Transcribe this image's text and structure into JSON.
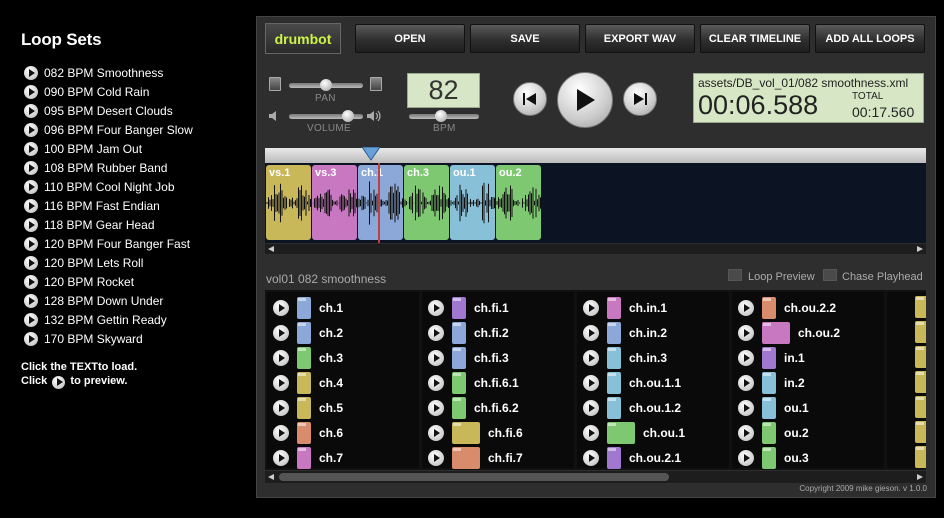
{
  "left": {
    "title": "Loop Sets",
    "sets": [
      "082 BPM Smoothness",
      "090 BPM Cold Rain",
      "095 BPM Desert Clouds",
      "096 BPM Four Banger Slow",
      "100 BPM Jam Out",
      "108 BPM Rubber Band",
      "110 BPM Cool Night Job",
      "116 BPM Fast Endian",
      "118 BPM Gear Head",
      "120 BPM Four Banger Fast",
      "120 BPM Lets Roll",
      "120 BPM Rocket",
      "128 BPM Down Under",
      "132 BPM Gettin Ready",
      "170 BPM Skyward"
    ],
    "help_line1": "Click the TEXTto load.",
    "help_click": "Click",
    "help_preview": "to preview."
  },
  "toolbar": {
    "logo": "drumbot",
    "open": "OPEN",
    "save": "SAVE",
    "export": "EXPORT WAV",
    "clear": "CLEAR TIMELINE",
    "add_all": "ADD ALL LOOPS"
  },
  "controls": {
    "pan_label": "PAN",
    "volume_label": "VOLUME",
    "bpm_label": "BPM",
    "bpm_value": "82",
    "pan_level": 0.5,
    "volume_level": 0.85,
    "bpm_level": 0.45
  },
  "display": {
    "file": "assets/DB_vol_01/082 smoothness.xml",
    "time": "00:06.588",
    "total_label": "TOTAL",
    "total": "00:17.560"
  },
  "timeline": {
    "clips": [
      {
        "label": "vs.1",
        "color": "#c8b85a"
      },
      {
        "label": "vs.3",
        "color": "#c878c0"
      },
      {
        "label": "ch.1",
        "color": "#8ca8d8"
      },
      {
        "label": "ch.3",
        "color": "#7dc870"
      },
      {
        "label": "ou.1",
        "color": "#88c0d8"
      },
      {
        "label": "ou.2",
        "color": "#7dc870"
      }
    ]
  },
  "loops_panel": {
    "title": "vol01 082 smoothness",
    "loop_preview": "Loop Preview",
    "chase_playhead": "Chase Playhead",
    "columns": [
      [
        {
          "label": "ch.1",
          "color": "#8ca8d8"
        },
        {
          "label": "ch.2",
          "color": "#8ca8d8"
        },
        {
          "label": "ch.3",
          "color": "#7dc870"
        },
        {
          "label": "ch.4",
          "color": "#c8b85a"
        },
        {
          "label": "ch.5",
          "color": "#c8b85a"
        },
        {
          "label": "ch.6",
          "color": "#d88c6c"
        },
        {
          "label": "ch.7",
          "color": "#c878c0"
        }
      ],
      [
        {
          "label": "ch.fi.1",
          "color": "#a078d0"
        },
        {
          "label": "ch.fi.2",
          "color": "#8ca8d8"
        },
        {
          "label": "ch.fi.3",
          "color": "#8ca8d8"
        },
        {
          "label": "ch.fi.6.1",
          "color": "#7dc870"
        },
        {
          "label": "ch.fi.6.2",
          "color": "#7dc870"
        },
        {
          "label": "ch.fi.6",
          "color": "#c8b85a",
          "wide": true
        },
        {
          "label": "ch.fi.7",
          "color": "#d88c6c",
          "wide": true
        }
      ],
      [
        {
          "label": "ch.in.1",
          "color": "#c878c0"
        },
        {
          "label": "ch.in.2",
          "color": "#8ca8d8"
        },
        {
          "label": "ch.in.3",
          "color": "#88c0d8"
        },
        {
          "label": "ch.ou.1.1",
          "color": "#88c0d8"
        },
        {
          "label": "ch.ou.1.2",
          "color": "#88c0d8"
        },
        {
          "label": "ch.ou.1",
          "color": "#7dc870",
          "wide": true
        },
        {
          "label": "ch.ou.2.1",
          "color": "#a078d0"
        }
      ],
      [
        {
          "label": "ch.ou.2.2",
          "color": "#d88c6c"
        },
        {
          "label": "ch.ou.2",
          "color": "#c878c0",
          "wide": true
        },
        {
          "label": "in.1",
          "color": "#a078d0"
        },
        {
          "label": "in.2",
          "color": "#88c0d8"
        },
        {
          "label": "ou.1",
          "color": "#88c0d8"
        },
        {
          "label": "ou.2",
          "color": "#7dc870"
        },
        {
          "label": "ou.3",
          "color": "#7dc870"
        }
      ]
    ]
  },
  "copyright": "Copyright 2009 mike gieson. v 1.0.0"
}
